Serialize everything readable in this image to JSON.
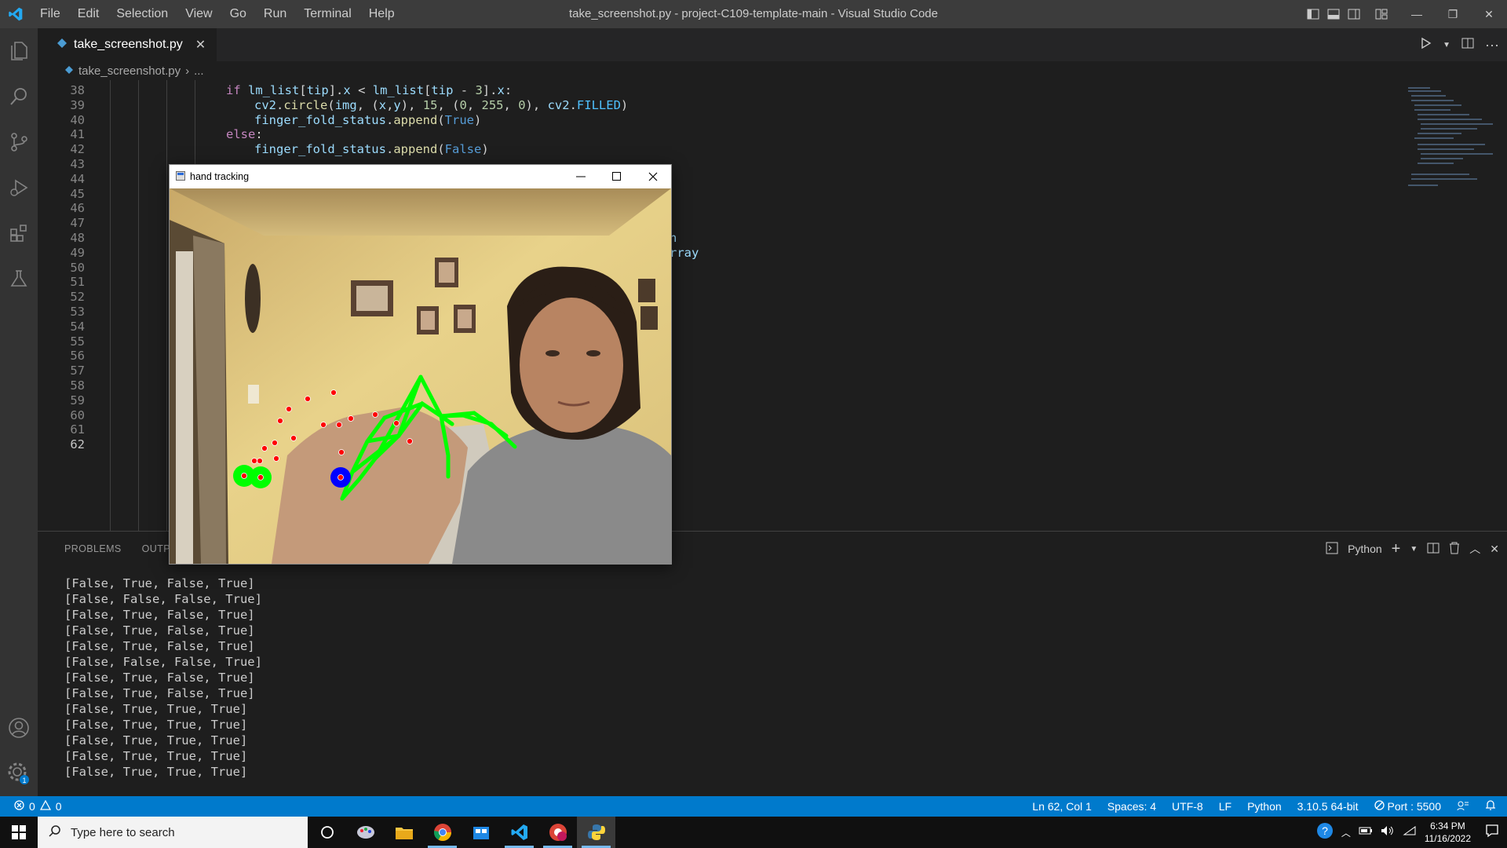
{
  "titlebar": {
    "menu": [
      "File",
      "Edit",
      "Selection",
      "View",
      "Go",
      "Run",
      "Terminal",
      "Help"
    ],
    "title": "take_screenshot.py - project-C109-template-main - Visual Studio Code"
  },
  "tab": {
    "label": "take_screenshot.py",
    "close": "✕"
  },
  "breadcrumb": {
    "file": "take_screenshot.py",
    "sep": "›",
    "more": "..."
  },
  "editor": {
    "lines": [
      {
        "n": "38",
        "code": "if lm_list[tip].x < lm_list[tip - 3].x:",
        "indent": 4
      },
      {
        "n": "39",
        "code": "cv2.circle(img, (x,y), 15, (0, 255, 0), cv2.FILLED)",
        "indent": 5
      },
      {
        "n": "40",
        "code": "finger_fold_status.append(True)",
        "indent": 5
      },
      {
        "n": "41",
        "code": "else:",
        "indent": 4
      },
      {
        "n": "42",
        "code": "finger_fold_status.append(False)",
        "indent": 5
      },
      {
        "n": "43",
        "code": "",
        "indent": 0
      },
      {
        "n": "44",
        "code": "",
        "indent": 0
      },
      {
        "n": "45",
        "code": "",
        "indent": 0
      },
      {
        "n": "46",
        "code": "",
        "indent": 0
      },
      {
        "n": "47",
        "code": "",
        "indent": 0
      },
      {
        "n": "48",
        "code": "n",
        "indent": 0
      },
      {
        "n": "49",
        "code": "rray",
        "indent": 0
      },
      {
        "n": "50",
        "code": "",
        "indent": 0
      },
      {
        "n": "51",
        "code": "",
        "indent": 0
      },
      {
        "n": "52",
        "code": "",
        "indent": 0
      },
      {
        "n": "53",
        "code": "",
        "indent": 0
      },
      {
        "n": "54",
        "code": "",
        "indent": 0
      },
      {
        "n": "55",
        "code": "",
        "indent": 0
      },
      {
        "n": "56",
        "code": "",
        "indent": 0
      },
      {
        "n": "57",
        "code": "",
        "indent": 0
      },
      {
        "n": "58",
        "code": "",
        "indent": 0
      },
      {
        "n": "59",
        "code": "",
        "indent": 0
      },
      {
        "n": "60",
        "code": "",
        "indent": 0
      },
      {
        "n": "61",
        "code": "",
        "indent": 0
      },
      {
        "n": "62",
        "code": "",
        "indent": 0
      }
    ]
  },
  "panel": {
    "tabs": [
      "PROBLEMS",
      "OUTPU"
    ],
    "terminal_label": "Python",
    "output": [
      "[False, True, False, True]",
      "[False, False, False, True]",
      "[False, True, False, True]",
      "[False, True, False, True]",
      "[False, True, False, True]",
      "[False, False, False, True]",
      "[False, True, False, True]",
      "[False, True, False, True]",
      "[False, True, True, True]",
      "[False, True, True, True]",
      "[False, True, True, True]",
      "[False, True, True, True]",
      "[False, True, True, True]"
    ]
  },
  "status": {
    "errors": "0",
    "warnings": "0",
    "position": "Ln 62, Col 1",
    "spaces": "Spaces: 4",
    "encoding": "UTF-8",
    "eol": "LF",
    "language": "Python",
    "interpreter": "3.10.5 64-bit",
    "port": "Port : 5500"
  },
  "popup": {
    "title": "hand tracking"
  },
  "taskbar": {
    "search_placeholder": "Type here to search",
    "time": "6:34 PM",
    "date": "11/16/2022"
  },
  "colors": {
    "statusbar": "#007acc",
    "accent": "#0078d4"
  }
}
